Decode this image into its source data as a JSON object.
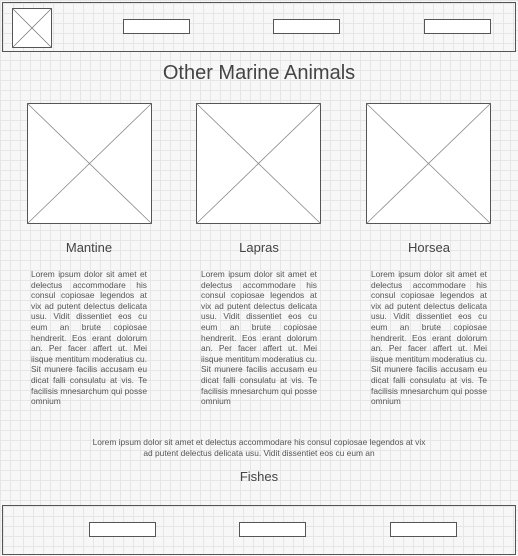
{
  "header": {
    "logo_icon": "image-placeholder-icon",
    "nav": [
      "",
      "",
      ""
    ]
  },
  "page": {
    "title": "Other Marine Animals"
  },
  "cards": [
    {
      "name": "Mantine",
      "image_icon": "image-placeholder-icon",
      "text": "Lorem ipsum dolor sit amet et delectus accommodare his consul copiosae legendos at vix ad putent delectus delicata usu. Vidit dissentiet eos cu eum an brute copiosae hendrerit. Eos erant dolorum an. Per facer affert ut. Mei iisque mentitum moderatius cu. Sit munere facilis accusam eu dicat falli consulatu at vis. Te facilisis mnesarchum qui posse omnium"
    },
    {
      "name": "Lapras",
      "image_icon": "image-placeholder-icon",
      "text": "Lorem ipsum dolor sit amet et delectus accommodare his consul copiosae legendos at vix ad putent delectus delicata usu. Vidit dissentiet eos cu eum an brute copiosae hendrerit. Eos erant dolorum an. Per facer affert ut. Mei iisque mentitum moderatius cu. Sit munere facilis accusam eu dicat falli consulatu at vis. Te facilisis mnesarchum qui posse omnium"
    },
    {
      "name": "Horsea",
      "image_icon": "image-placeholder-icon",
      "text": "Lorem ipsum dolor sit amet et delectus accommodare his consul copiosae legendos at vix ad putent delectus delicata usu. Vidit dissentiet eos cu eum an brute copiosae hendrerit. Eos erant dolorum an. Per facer affert ut. Mei iisque mentitum moderatius cu. Sit munere facilis accusam eu dicat falli consulatu at vis. Te facilisis mnesarchum qui posse omnium"
    }
  ],
  "intro_text": "Lorem ipsum dolor sit amet et delectus accommodare his consul copiosae legendos at vix ad putent delectus delicata usu. Vidit dissentiet eos cu eum an",
  "section": {
    "title": "Fishes"
  },
  "footer": {
    "nav": [
      "",
      "",
      ""
    ]
  }
}
